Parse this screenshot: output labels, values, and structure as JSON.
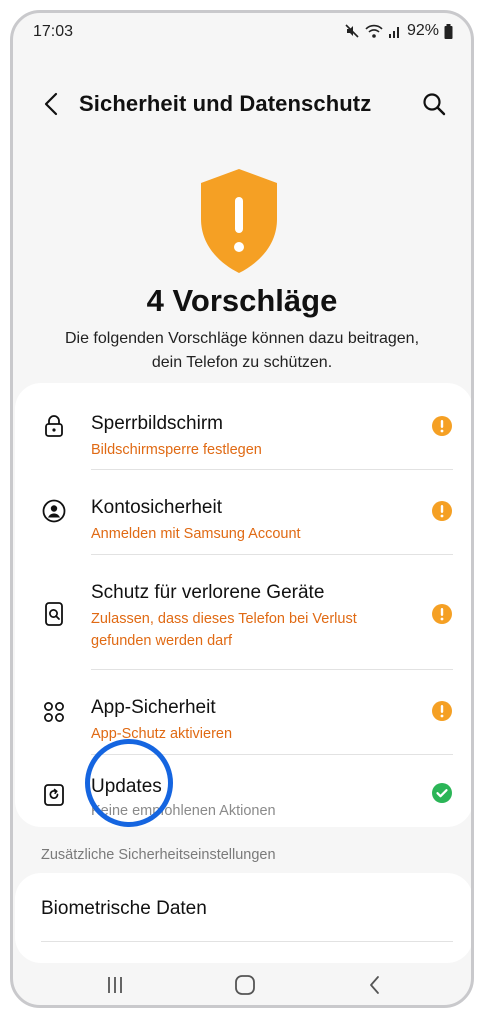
{
  "status_bar": {
    "time": "17:03",
    "battery": "92%"
  },
  "app_bar": {
    "title": "Sicherheit und Datenschutz"
  },
  "hero": {
    "headline": "4 Vorschläge",
    "description_line1": "Die folgenden Vorschläge können dazu beitragen,",
    "description_line2": "dein Telefon zu schützen."
  },
  "suggestions": [
    {
      "title": "Sperrbildschirm",
      "subtitle": "Bildschirmsperre festlegen",
      "icon": "lock-icon",
      "status": "warning"
    },
    {
      "title": "Kontosicherheit",
      "subtitle": "Anmelden mit Samsung Account",
      "icon": "account-icon",
      "status": "warning"
    },
    {
      "title": "Schutz für verlorene Geräte",
      "subtitle_line1": "Zulassen, dass dieses Telefon bei Verlust",
      "subtitle_line2": "gefunden werden darf",
      "icon": "find-device-icon",
      "status": "warning"
    },
    {
      "title": "App-Sicherheit",
      "subtitle": "App-Schutz aktivieren",
      "icon": "apps-icon",
      "status": "warning"
    },
    {
      "title": "Updates",
      "subtitle": "Keine empfohlenen Aktionen",
      "icon": "update-icon",
      "status": "ok"
    }
  ],
  "additional": {
    "section_label": "Zusätzliche Sicherheitseinstellungen",
    "items": [
      {
        "title": "Biometrische Daten"
      }
    ]
  },
  "colors": {
    "warning": "#f5a024",
    "ok": "#2bb557",
    "subtitle_warning": "#e06a14",
    "highlight": "#1565e0"
  }
}
